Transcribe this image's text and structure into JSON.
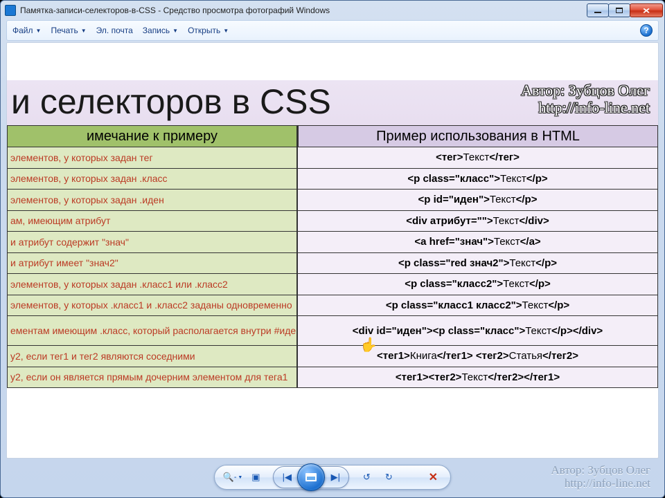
{
  "window": {
    "title": "Памятка-записи-селекторов-в-CSS - Средство просмотра фотографий Windows"
  },
  "menu": {
    "file": "Файл",
    "print": "Печать",
    "email": "Эл. почта",
    "burn": "Запись",
    "open": "Открыть",
    "help_tooltip": "?"
  },
  "watermark": {
    "author": "Автор: Зубцов Олег",
    "url": "http://info-line.net"
  },
  "document": {
    "big_title": "и селекторов в CSS",
    "col_left": "имечание к примеру",
    "col_right": "Пример использования в HTML",
    "rows": [
      {
        "note": "элементов, у которых задан тег",
        "html": "<тег>Текст</тег>"
      },
      {
        "note": "элементов, у которых задан .класс",
        "html": "<p class=\"класс\">Текст</p>"
      },
      {
        "note": "элементов, у которых задан .иден",
        "html": "<p id=\"иден\">Текст</p>"
      },
      {
        "note": "ам, имеющим атрибут",
        "html": "<div атрибут=\"\">Текст</div>"
      },
      {
        "note": "и атрибут содержит \"знач\"",
        "html": "<a href=\"знач\">Текст</a>"
      },
      {
        "note": "и атрибут имеет \"знач2\"",
        "html": "<p class=\"red знач2\">Текст</p>"
      },
      {
        "note": "элементов, у которых задан .класс1 или .класс2",
        "html": "<p class=\"класс2\">Текст</p>"
      },
      {
        "note": "элементов, у которых .класс1 и .класс2 заданы одновременно",
        "html": "<p class=\"класс1 класс2\">Текст</p>"
      },
      {
        "note": "ементам имеющим .класс, который располагается внутри #иден",
        "html": "<div id=\"иден\"><p class=\"класс\">Текст</p></div>",
        "h": true
      },
      {
        "note": "у2, если тег1 и тег2 являются соседними",
        "html": "<тег1>Книга</тег1> <тег2>Статья</тег2>"
      },
      {
        "note": "у2, если он является прямым дочерним элементом для тега1",
        "html": "<тег1><тег2>Текст</тег2></тег1>"
      }
    ]
  },
  "toolbar": {
    "zoom_out": "🔍",
    "fit": "▣",
    "prev": "|◀",
    "next": "▶|",
    "rotate_ccw": "↺",
    "rotate_cw": "↻",
    "delete": "✕"
  }
}
